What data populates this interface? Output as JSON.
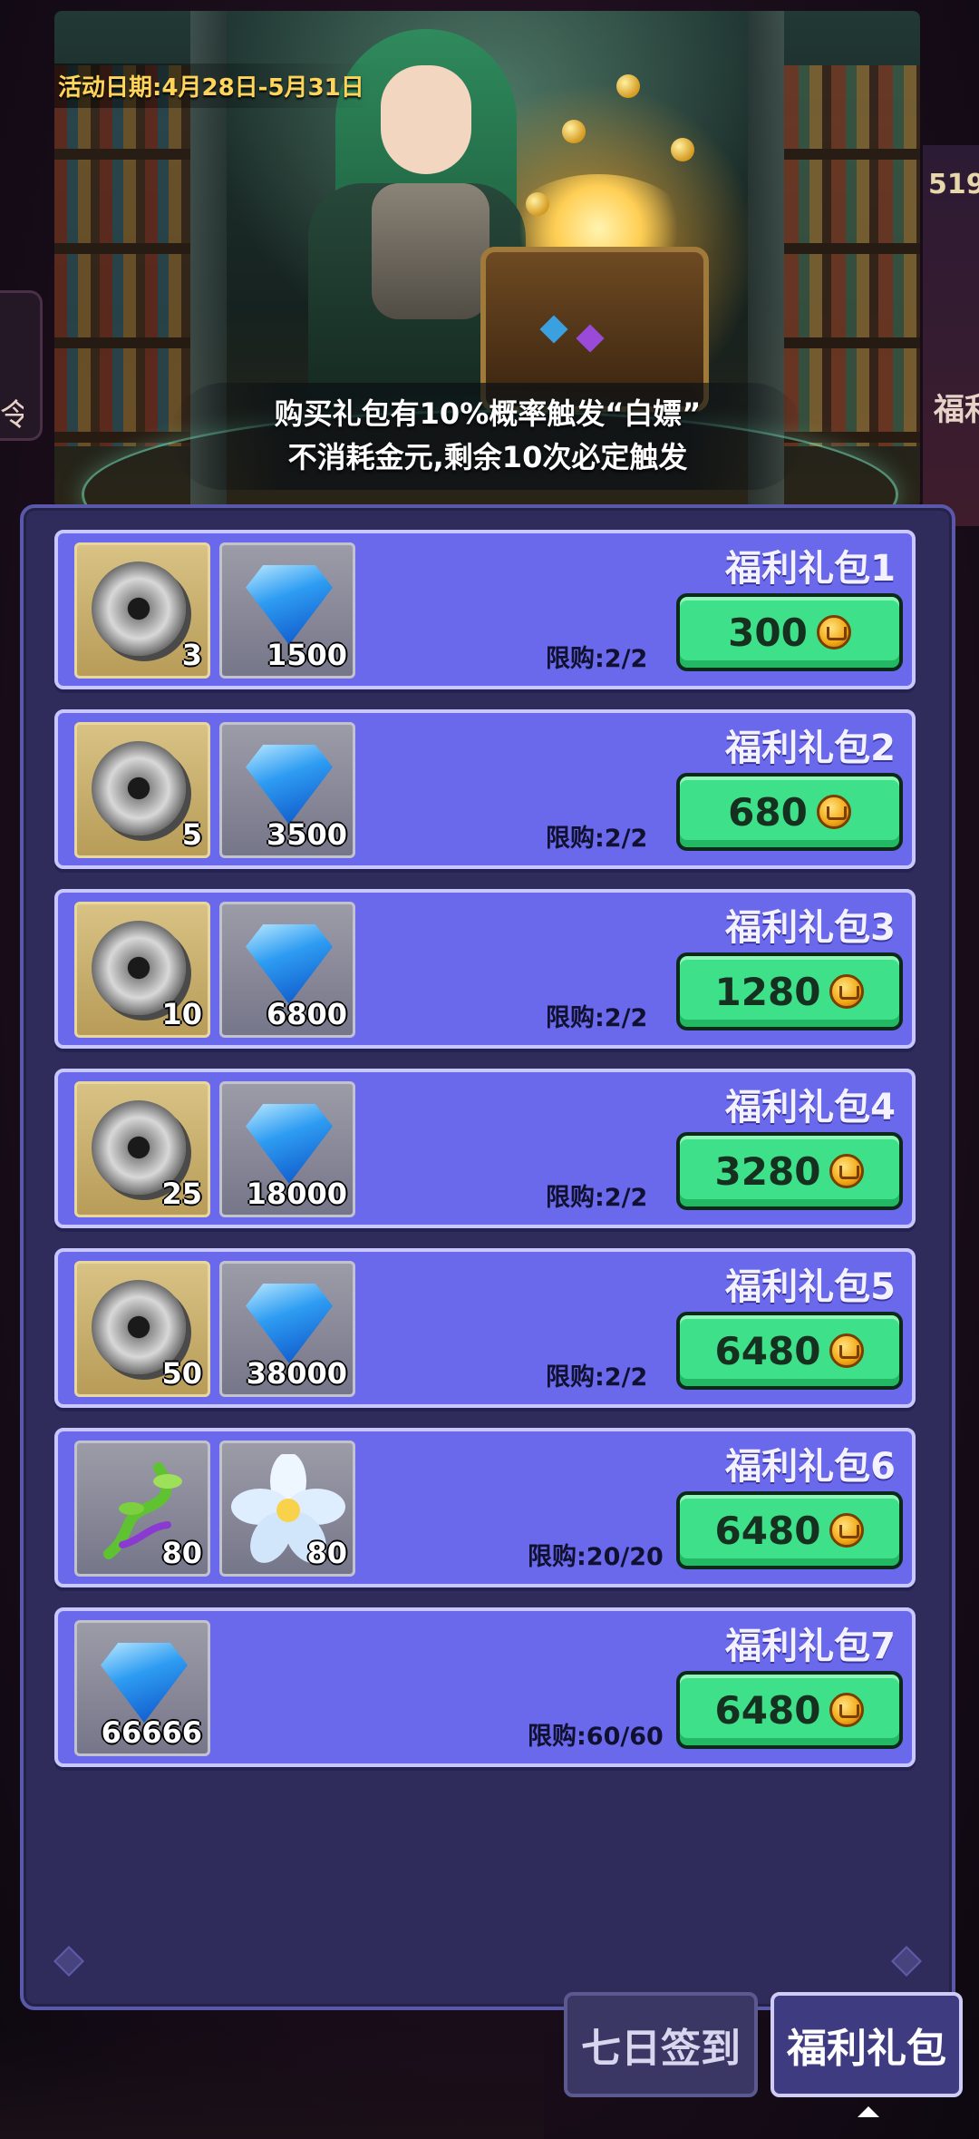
{
  "banner": {
    "event_date": "活动日期:4月28日-5月31日",
    "caption_line1": "购买礼包有10%概率触发“白嫖”",
    "caption_line2": "不消耗金元,剩余10次必定触发"
  },
  "background": {
    "right_number": "519",
    "right_label": "福利",
    "left_label": "令"
  },
  "packs": [
    {
      "title": "福利礼包1",
      "limit": "限购:2/2",
      "price": "300",
      "items": [
        {
          "icon": "iron-ring-icon",
          "qty": "3"
        },
        {
          "icon": "blue-diamond-icon",
          "qty": "1500"
        }
      ]
    },
    {
      "title": "福利礼包2",
      "limit": "限购:2/2",
      "price": "680",
      "items": [
        {
          "icon": "iron-ring-icon",
          "qty": "5"
        },
        {
          "icon": "blue-diamond-icon",
          "qty": "3500"
        }
      ]
    },
    {
      "title": "福利礼包3",
      "limit": "限购:2/2",
      "price": "1280",
      "items": [
        {
          "icon": "iron-ring-icon",
          "qty": "10"
        },
        {
          "icon": "blue-diamond-icon",
          "qty": "6800"
        }
      ]
    },
    {
      "title": "福利礼包4",
      "limit": "限购:2/2",
      "price": "3280",
      "items": [
        {
          "icon": "iron-ring-icon",
          "qty": "25"
        },
        {
          "icon": "blue-diamond-icon",
          "qty": "18000"
        }
      ]
    },
    {
      "title": "福利礼包5",
      "limit": "限购:2/2",
      "price": "6480",
      "items": [
        {
          "icon": "iron-ring-icon",
          "qty": "50"
        },
        {
          "icon": "blue-diamond-icon",
          "qty": "38000"
        }
      ]
    },
    {
      "title": "福利礼包6",
      "limit": "限购:20/20",
      "price": "6480",
      "items": [
        {
          "icon": "green-vine-icon",
          "qty": "80"
        },
        {
          "icon": "white-flower-icon",
          "qty": "80"
        }
      ]
    },
    {
      "title": "福利礼包7",
      "limit": "限购:60/60",
      "price": "6480",
      "items": [
        {
          "icon": "blue-diamond-icon",
          "qty": "66666"
        }
      ]
    }
  ],
  "tabs": {
    "signin": "七日签到",
    "welfare": "福利礼包",
    "active": "welfare"
  },
  "colors": {
    "card_bg": "#6a69ec",
    "button_green": "#3fe08a",
    "panel_bg": "#2f2b5a",
    "date_gold": "#ffd45a"
  }
}
